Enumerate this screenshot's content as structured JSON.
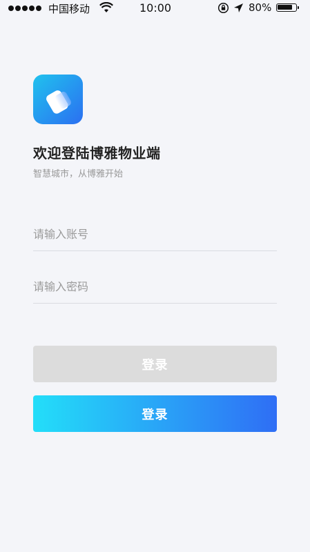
{
  "status_bar": {
    "carrier": "中国移动",
    "time": "10:00",
    "battery": "80%"
  },
  "header": {
    "title": "欢迎登陆博雅物业端",
    "subtitle": "智慧城市，从博雅开始"
  },
  "form": {
    "account_placeholder": "请输入账号",
    "password_placeholder": "请输入密码",
    "login_disabled_label": "登录",
    "login_label": "登录"
  },
  "colors": {
    "background": "#f4f5f9",
    "accent_start": "#23def9",
    "accent_end": "#2f6ef5",
    "disabled": "#dcdcdc"
  }
}
